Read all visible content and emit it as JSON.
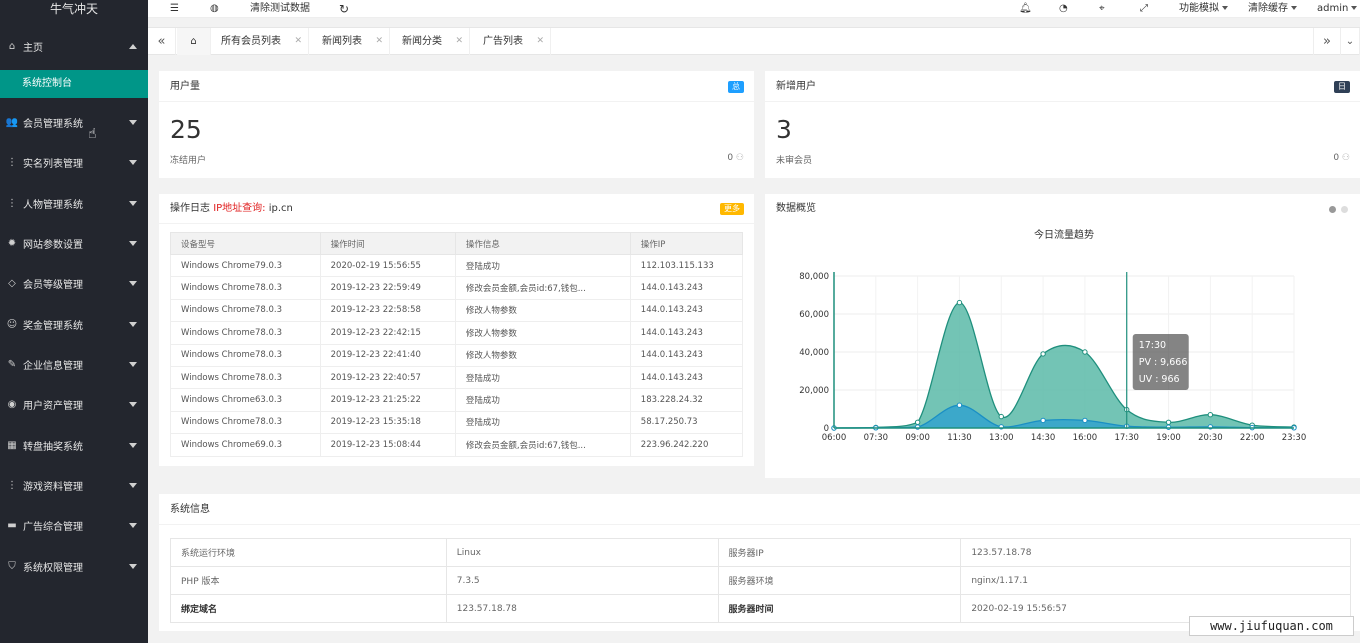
{
  "app": {
    "title": "牛气冲天"
  },
  "sidebar": {
    "items": [
      {
        "label": "主页",
        "icon": "home-icon",
        "glyph": "⌂",
        "caret": "up"
      },
      {
        "label": "会员管理系统",
        "icon": "users-icon",
        "glyph": "👥",
        "caret": "down"
      },
      {
        "label": "实名列表管理",
        "icon": "dots-icon",
        "glyph": "⋮",
        "caret": "down"
      },
      {
        "label": "人物管理系统",
        "icon": "dots-icon",
        "glyph": "⋮",
        "caret": "down"
      },
      {
        "label": "网站参数设置",
        "icon": "gear-icon",
        "glyph": "✹",
        "caret": "down"
      },
      {
        "label": "会员等级管理",
        "icon": "diamond-icon",
        "glyph": "◇",
        "caret": "down"
      },
      {
        "label": "奖金管理系统",
        "icon": "smile-icon",
        "glyph": "☺",
        "caret": "down"
      },
      {
        "label": "企业信息管理",
        "icon": "edit-icon",
        "glyph": "✎",
        "caret": "down"
      },
      {
        "label": "用户资产管理",
        "icon": "chat-icon",
        "glyph": "◉",
        "caret": "down"
      },
      {
        "label": "转盘抽奖系统",
        "icon": "grid-icon",
        "glyph": "▦",
        "caret": "down"
      },
      {
        "label": "游戏资料管理",
        "icon": "dots-icon",
        "glyph": "⋮",
        "caret": "down"
      },
      {
        "label": "广告综合管理",
        "icon": "message-icon",
        "glyph": "▬",
        "caret": "down"
      },
      {
        "label": "系统权限管理",
        "icon": "shield-icon",
        "glyph": "⛉",
        "caret": "down"
      }
    ],
    "active_sub": "系统控制台"
  },
  "header": {
    "clear_test": "清除测试数据",
    "function_mode": "功能模拟",
    "clear_cache": "清除缓存",
    "user": "admin"
  },
  "tabs": [
    {
      "label": "所有会员列表"
    },
    {
      "label": "新闻列表"
    },
    {
      "label": "新闻分类"
    },
    {
      "label": "广告列表"
    }
  ],
  "users_card": {
    "title": "用户量",
    "badge": "总",
    "badge_color": "#1e9fff",
    "value": "25",
    "sub_label": "冻结用户",
    "sub_value": "0"
  },
  "new_users_card": {
    "title": "新增用户",
    "badge": "日",
    "badge_color": "#2f4056",
    "value": "3",
    "sub_label": "未审会员",
    "sub_value": "0"
  },
  "log_card": {
    "title": "操作日志",
    "ip_query": "IP地址查询:",
    "ip_site": "ip.cn",
    "badge": "更多",
    "badge_color": "#ffb800",
    "headers": [
      "设备型号",
      "操作时间",
      "操作信息",
      "操作IP"
    ],
    "rows": [
      [
        "Windows Chrome79.0.3",
        "2020-02-19 15:56:55",
        "登陆成功",
        "112.103.115.133"
      ],
      [
        "Windows Chrome78.0.3",
        "2019-12-23 22:59:49",
        "修改会员金额,会员id:67,钱包...",
        "144.0.143.243"
      ],
      [
        "Windows Chrome78.0.3",
        "2019-12-23 22:58:58",
        "修改人物参数",
        "144.0.143.243"
      ],
      [
        "Windows Chrome78.0.3",
        "2019-12-23 22:42:15",
        "修改人物参数",
        "144.0.143.243"
      ],
      [
        "Windows Chrome78.0.3",
        "2019-12-23 22:41:40",
        "修改人物参数",
        "144.0.143.243"
      ],
      [
        "Windows Chrome78.0.3",
        "2019-12-23 22:40:57",
        "登陆成功",
        "144.0.143.243"
      ],
      [
        "Windows Chrome63.0.3",
        "2019-12-23 21:25:22",
        "登陆成功",
        "183.228.24.32"
      ],
      [
        "Windows Chrome78.0.3",
        "2019-12-23 15:35:18",
        "登陆成功",
        "58.17.250.73"
      ],
      [
        "Windows Chrome69.0.3",
        "2019-12-23 15:08:44",
        "修改会员金额,会员id:67,钱包...",
        "223.96.242.220"
      ]
    ]
  },
  "overview_card": {
    "title": "数据概览"
  },
  "chart_data": {
    "type": "area",
    "title": "今日流量趋势",
    "categories": [
      "06:00",
      "07:30",
      "09:00",
      "11:30",
      "13:00",
      "14:30",
      "16:00",
      "17:30",
      "19:00",
      "20:30",
      "22:00",
      "23:30"
    ],
    "series": [
      {
        "name": "PV",
        "color": "#5bbaa8",
        "values": [
          0,
          300,
          3000,
          66000,
          6000,
          39000,
          40000,
          9666,
          3000,
          7000,
          1500,
          500
        ]
      },
      {
        "name": "UV",
        "color": "#2ea1cf",
        "values": [
          0,
          100,
          500,
          12000,
          600,
          4000,
          4000,
          966,
          400,
          600,
          200,
          100
        ]
      }
    ],
    "ylim": [
      0,
      80000
    ],
    "yticks": [
      "0",
      "20,000",
      "40,000",
      "60,000",
      "80,000"
    ],
    "tooltip": {
      "time": "17:30",
      "pv": "PV : 9,666",
      "uv": "UV : 966"
    }
  },
  "sysinfo": {
    "title": "系统信息",
    "rows": [
      [
        "系统运行环境",
        "Linux",
        "服务器IP",
        "123.57.18.78"
      ],
      [
        "PHP 版本",
        "7.3.5",
        "服务器环境",
        "nginx/1.17.1"
      ],
      [
        "绑定域名",
        "123.57.18.78",
        "服务器时间",
        "2020-02-19 15:56:57"
      ]
    ]
  },
  "watermark": "www.jiufuquan.com"
}
